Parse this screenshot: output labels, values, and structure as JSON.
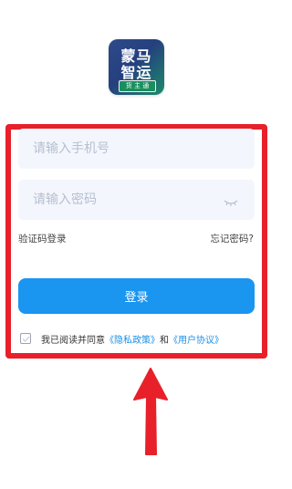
{
  "logo": {
    "line1": "蒙马",
    "line2": "智运",
    "sub": "货 主 通"
  },
  "form": {
    "phone_placeholder": "请输入手机号",
    "password_placeholder": "请输入密码",
    "sms_login_label": "验证码登录",
    "forgot_password_label": "忘记密码?",
    "login_button_label": "登录"
  },
  "agreement": {
    "prefix": "我已阅读并同意",
    "privacy_policy": "《隐私政策》",
    "and": "和",
    "user_agreement": "《用户协议》",
    "checked": false
  },
  "colors": {
    "accent": "#1a95f0",
    "link": "#1a8fe8",
    "highlight_frame": "#e8202a",
    "input_bg": "#f3f6fd"
  },
  "icons": [
    "eye-closed-icon",
    "checkbox-icon",
    "red-arrow-up-icon"
  ]
}
